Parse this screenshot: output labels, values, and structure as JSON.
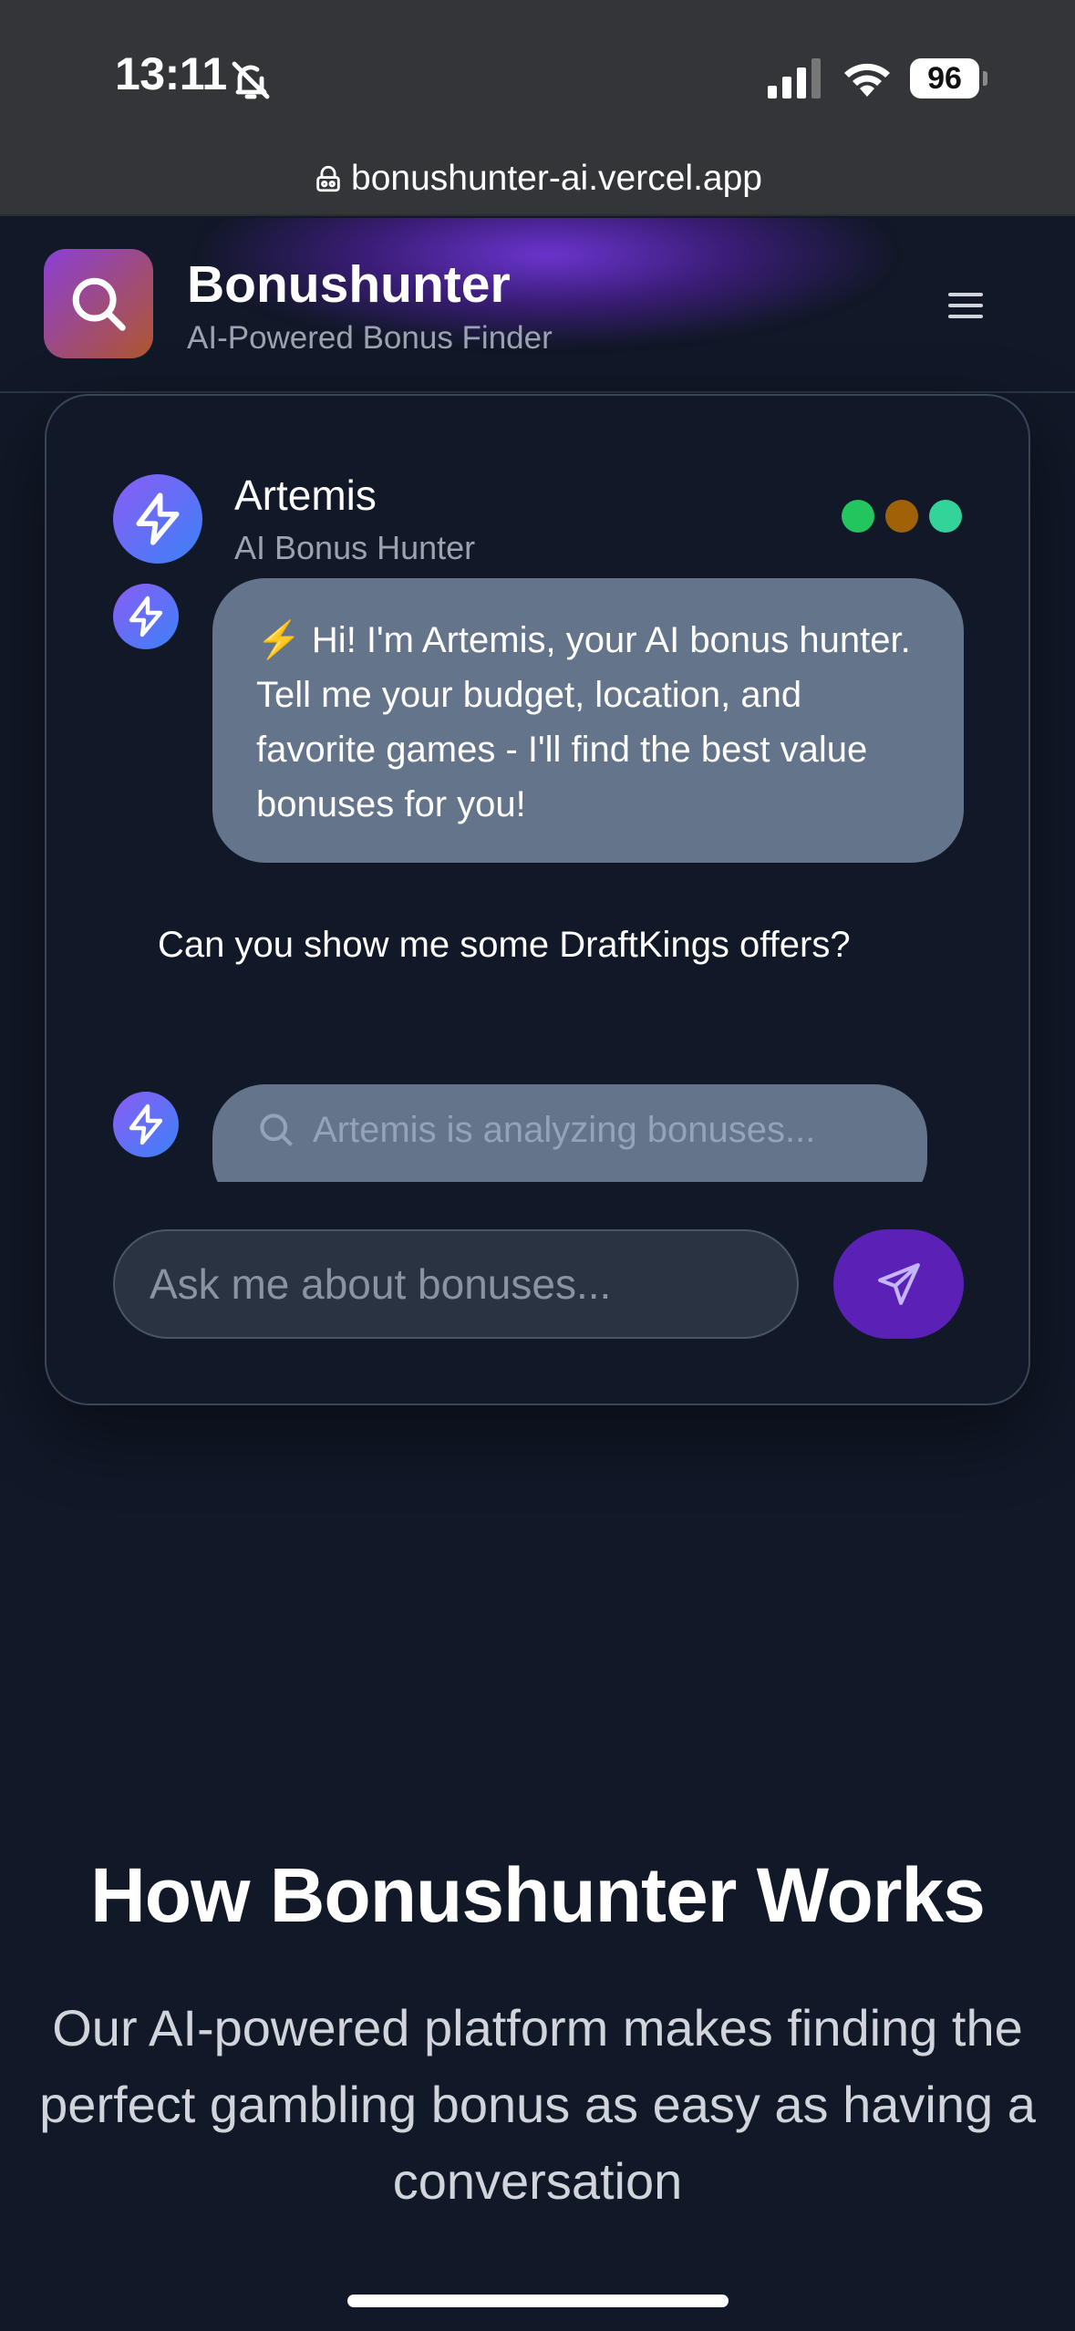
{
  "status_bar": {
    "time": "13:11",
    "battery": "96",
    "url": "bonushunter-ai.vercel.app"
  },
  "header": {
    "title": "Bonushunter",
    "subtitle": "AI-Powered Bonus Finder",
    "logo_icon": "search-icon",
    "menu_icon": "hamburger-menu-icon"
  },
  "chat": {
    "assistant_name": "Artemis",
    "assistant_role": "AI Bonus Hunter",
    "status_dots": [
      "#22c55e",
      "#a16207",
      "#34d399"
    ],
    "messages": {
      "bot_greeting": "⚡ Hi! I'm Artemis, your AI bonus hunter. Tell me your budget, location, and favorite games - I'll find the best value bonuses for you!",
      "user_message": "Can you show me some DraftKings offers?",
      "typing": "Artemis is analyzing bonuses..."
    },
    "input_placeholder": "Ask me about bonuses...",
    "send_icon": "send-icon"
  },
  "how_it_works": {
    "title": "How Bonushunter Works",
    "description": "Our AI-powered platform makes finding the perfect gambling bonus as easy as having a conversation"
  },
  "colors": {
    "background": "#111827",
    "accent": "#5b21b6",
    "bubble": "#64748b"
  }
}
